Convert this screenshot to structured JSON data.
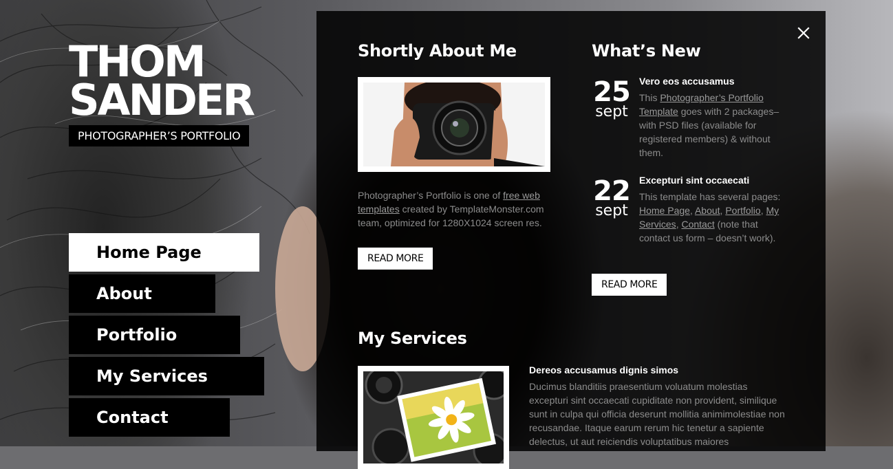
{
  "logo": {
    "line1": "THOM",
    "line2": "SANDER",
    "tagline": "PHOTOGRAPHER’S PORTFOLIO"
  },
  "nav": {
    "items": [
      {
        "label": "Home Page",
        "active": true
      },
      {
        "label": "About",
        "active": false
      },
      {
        "label": "Portfolio",
        "active": false
      },
      {
        "label": "My Services",
        "active": false
      },
      {
        "label": "Contact",
        "active": false
      }
    ]
  },
  "about": {
    "heading": "Shortly About Me",
    "text_pre": "Photographer’s Portfolio is one of ",
    "text_link": "free web templates",
    "text_post": " created by TemplateMonster.com team, optimized for 1280X1024 screen res.",
    "button": "READ MORE"
  },
  "news": {
    "heading": "What’s New",
    "items": [
      {
        "day": "25",
        "month": "sept",
        "title": "Vero eos accusamus",
        "text_pre": "This ",
        "text_link": "Photographer’s Portfolio Template",
        "text_post": " goes with 2 packages– with PSD files (available for registered members) & without them."
      },
      {
        "day": "22",
        "month": "sept",
        "title": "Excepturi sint occaecati",
        "text_pre": "This template has several pages: ",
        "links": [
          "Home Page",
          "About",
          "Portfolio",
          "My Services",
          "Contact"
        ],
        "text_post": " (note that contact us form – doesn’t work)."
      }
    ],
    "button": "READ MORE"
  },
  "services": {
    "heading": "My Services",
    "title": "Dereos accusamus dignis simos",
    "text": "Ducimus blanditiis praesentium voluatum molestias excepturi sint occaecati cupiditate non provident, similique sunt in culpa qui officia deserunt mollitia animimolestiae non recusandae. Itaque earum rerum hic tenetur a sapiente delectus, ut aut reiciendis voluptatibus maiores"
  },
  "icons": {
    "close": "close-icon"
  },
  "colors": {
    "panel_bg": "#000000",
    "text_muted": "#8c8c8c",
    "accent_white": "#ffffff"
  }
}
